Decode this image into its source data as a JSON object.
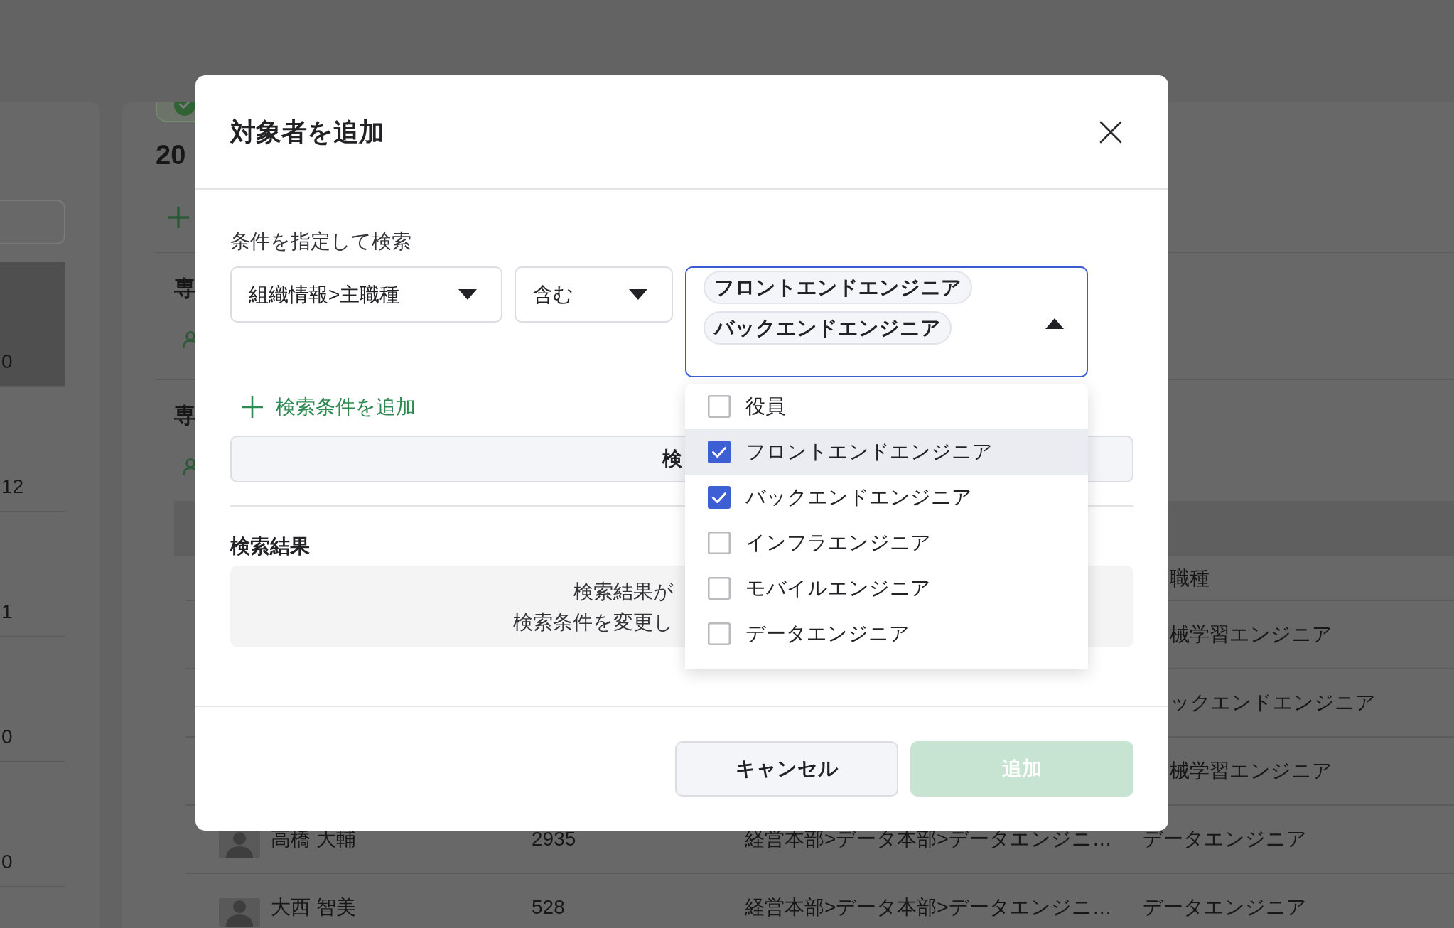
{
  "background": {
    "side_list": {
      "rows": [
        {
          "text": "0",
          "selected": true
        },
        {
          "text": "12",
          "selected": false
        },
        {
          "text": "1",
          "selected": false
        },
        {
          "text": "0",
          "selected": false
        },
        {
          "text": "0",
          "selected": false
        }
      ]
    },
    "main": {
      "title": "20",
      "sections": [
        {
          "title": "専"
        },
        {
          "title": "専"
        }
      ],
      "table": {
        "header": {
          "kind": "partial",
          "job_title": "職種"
        },
        "rows": [
          {
            "kind": "partial",
            "job_title": "械学習エンジニア"
          },
          {
            "kind": "partial",
            "job_title": "ックエンドエンジニア"
          },
          {
            "kind": "partial",
            "job_title": "械学習エンジニア"
          },
          {
            "kind": "full",
            "name": "高橋 大輔",
            "number": "2935",
            "department": "経営本部>データ本部>データエンジニ…",
            "job_title": "データエンジニア"
          },
          {
            "kind": "full",
            "name": "大西 智美",
            "number": "528",
            "department": "経営本部>データ本部>データエンジニ…",
            "job_title": "データエンジニア"
          }
        ]
      }
    }
  },
  "dialog": {
    "title": "対象者を追加",
    "search": {
      "label": "条件を指定して検索",
      "condition": {
        "field": {
          "value": "組織情報>主職種",
          "expanded": false
        },
        "operator": {
          "value": "含む",
          "expanded": false
        },
        "values": {
          "chips": [
            "フロントエンドエンジニア",
            "バックエンドエンジニア"
          ],
          "expanded": true,
          "options": [
            {
              "label": "役員",
              "checked": false,
              "highlighted": false
            },
            {
              "label": "フロントエンドエンジニア",
              "checked": true,
              "highlighted": true
            },
            {
              "label": "バックエンドエンジニア",
              "checked": true,
              "highlighted": false
            },
            {
              "label": "インフラエンジニア",
              "checked": false,
              "highlighted": false
            },
            {
              "label": "モバイルエンジニア",
              "checked": false,
              "highlighted": false
            },
            {
              "label": "データエンジニア",
              "checked": false,
              "highlighted": false
            }
          ]
        }
      },
      "add_condition": "検索条件を追加",
      "search_button": "検"
    },
    "results": {
      "title": "検索結果",
      "empty_message": [
        "検索結果が",
        "検索条件を変更し"
      ]
    },
    "buttons": [
      {
        "label": "キャンセル",
        "kind": "secondary",
        "disabled": false
      },
      {
        "label": "追加",
        "kind": "primary",
        "disabled": true
      }
    ]
  }
}
